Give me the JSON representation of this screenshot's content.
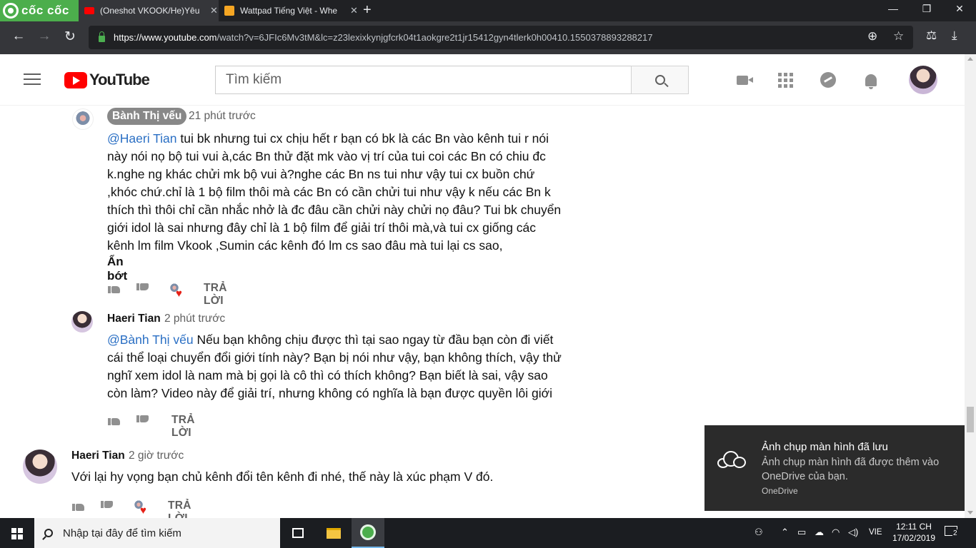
{
  "browser": {
    "brand": "cốc cốc",
    "tabs": [
      {
        "title": "(Oneshot VKOOK/He)Yêu",
        "color": "#ff0000"
      },
      {
        "title": "Wattpad Tiếng Việt - Whe",
        "color": "#f5a623"
      }
    ],
    "url_host": "https://www.youtube.com",
    "url_path": "/watch?v=6JFIc6Mv3tM&lc=z23lexixkynjgfcrk04t1aokgre2t1jr15412gyn4tlerk0h00410.1550378893288217"
  },
  "youtube": {
    "logo_text": "YouTube",
    "search_placeholder": "Tìm kiếm"
  },
  "comments": [
    {
      "author": "Bành Thị vếu",
      "time": "21 phút trước",
      "mention": "@Haeri Tian",
      "lines": [
        " tui bk nhưng tui cx chịu hết r bạn có bk là các Bn vào kênh tui r nói",
        "này nói nọ bộ tui vui à,các Bn thử đặt mk vào vị trí của tui coi các Bn có chiu đc",
        "k.nghe ng khác chửi mk bộ vui à?nghe các Bn ns tui như vậy tui cx buồn chứ",
        ",khóc chứ.chỉ là 1 bộ film thôi mà các Bn có cần chửi tui như vậy k nếu các Bn k",
        "thích thì thôi chỉ cần nhắc nhở là đc đâu cần chửi này chửi nọ đâu? Tui bk chuyển",
        "giới idol là sai nhưng đây chỉ là 1 bộ film để giải trí thôi mà,và tui cx giống các",
        "kênh lm film Vkook ,Sumin các kênh đó lm cs sao đâu mà tui lại cs sao,"
      ],
      "show_less": "Ẩn bớt",
      "reply": "TRẢ LỜI"
    },
    {
      "author": "Haeri Tian",
      "time": "2 phút trước",
      "mention": "@Bành Thị vếu",
      "lines": [
        " Nếu bạn không chịu được thì tại sao ngay từ đầu bạn còn đi viết",
        "cái thể loại chuyển đổi giới tính này? Bạn bị nói như vậy, bạn không thích, vậy thử",
        "nghĩ xem idol là nam mà bị gọi là cô thì có thích không? Bạn biết là sai, vậy sao",
        "còn làm? Video này để giải trí, nhưng không có nghĩa là bạn được quyền lôi giới"
      ],
      "reply": "TRẢ LỜI"
    },
    {
      "author": "Haeri Tian",
      "time": "2 giờ trước",
      "text": "Với lại hy vọng bạn chủ kênh đổi tên kênh đi nhé, thế này là xúc phạm V đó.",
      "reply": "TRẢ LỜI"
    }
  ],
  "toast": {
    "title": "Ảnh chụp màn hình đã lưu",
    "message": "Ảnh chụp màn hình đã được thêm vào OneDrive của bạn.",
    "app": "OneDrive"
  },
  "taskbar": {
    "search_placeholder": "Nhập tại đây để tìm kiếm",
    "language": "VIE",
    "time": "12:11 CH",
    "date": "17/02/2019",
    "notification_count": "2"
  }
}
